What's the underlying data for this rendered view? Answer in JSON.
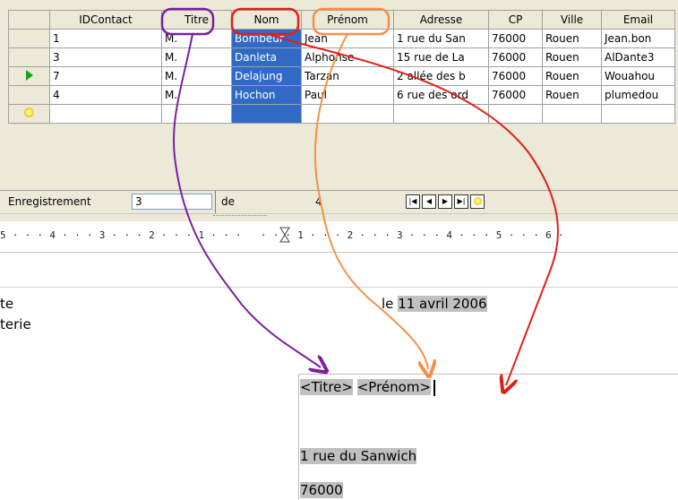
{
  "table": {
    "columns": [
      "IDContact",
      "Titre",
      "Nom",
      "Prénom",
      "Adresse",
      "CP",
      "Ville",
      "Email"
    ],
    "rows": [
      {
        "cells": [
          "1",
          "M.",
          "Bombeur",
          "Jean",
          "1 rue du San",
          "76000",
          "Rouen",
          "Jean.bon"
        ],
        "marker": ""
      },
      {
        "cells": [
          "3",
          "M.",
          "Danleta",
          "Alphonse",
          "15 rue de La",
          "76000",
          "Rouen",
          "AlDante3"
        ],
        "marker": ""
      },
      {
        "cells": [
          "7",
          "M.",
          "Delajung",
          "Tarzan",
          "2 allée des b",
          "76000",
          "Rouen",
          "Wouahou"
        ],
        "marker": "current"
      },
      {
        "cells": [
          "4",
          "M.",
          "Hochon",
          "Paul",
          "6 rue des ord",
          "76000",
          "Rouen",
          "plumedou"
        ],
        "marker": ""
      }
    ],
    "new_row_icon": "new-record-star-icon",
    "selected_column": "Nom"
  },
  "navbar": {
    "record_label": "Enregistrement",
    "record_value": "3",
    "of_label": "de",
    "total": "4",
    "buttons": [
      "first-record-icon",
      "previous-record-icon",
      "next-record-icon",
      "last-record-icon",
      "new-record-icon"
    ]
  },
  "ruler": {
    "text": "5 · · · 4 · · · 3 · · · 2 · · · 1 · · ·   · · · 1 · · · 2 · · · 3 · · · 4 · · · 5 · · · 6 · "
  },
  "document": {
    "left_fragment_1": "te",
    "left_fragment_2": "terie",
    "date_prefix": "le",
    "date_field": "11 avril 2006",
    "field_titre": "<Titre>",
    "field_prenom": "<Prénom>",
    "address_field": "1 rue du Sanwich",
    "cp_field": "76000"
  },
  "colors": {
    "titre_arrow": "#7b1fa2",
    "nom_arrow": "#e0201b",
    "prenom_arrow": "#f5904a",
    "selection": "#316ac5",
    "field_bg": "#c0c0c0"
  }
}
